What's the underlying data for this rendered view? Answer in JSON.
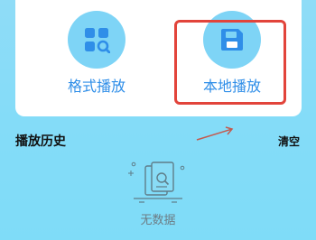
{
  "quick_actions": [
    {
      "label": "格式播放",
      "icon": "grid-search-icon"
    },
    {
      "label": "本地播放",
      "icon": "floppy-disk-icon"
    }
  ],
  "history": {
    "title": "播放历史",
    "clear_label": "清空",
    "empty_text": "无数据"
  },
  "colors": {
    "accent": "#2f8ee8",
    "icon_circle": "#7ed4f6",
    "highlight": "#e2443b"
  }
}
